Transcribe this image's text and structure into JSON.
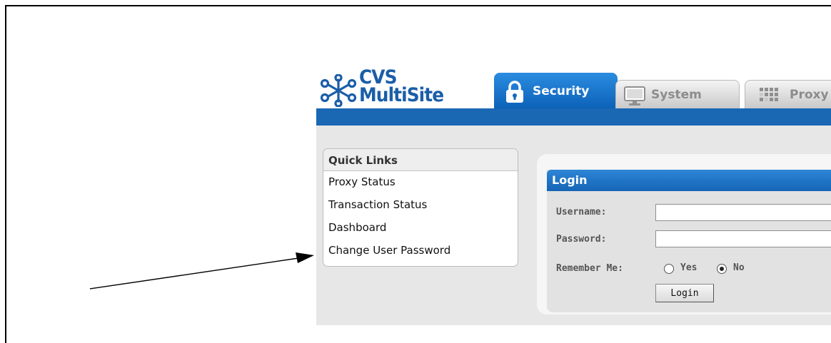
{
  "brand": {
    "line1": "CVS",
    "line2": "MultiSite",
    "color": "#1a5ea8"
  },
  "tabs": [
    {
      "label": "Security",
      "icon": "lock-icon",
      "active": true
    },
    {
      "label": "System",
      "icon": "monitor-icon",
      "active": false
    },
    {
      "label": "Proxy",
      "icon": "proxy-icon",
      "active": false
    }
  ],
  "quick_links": {
    "title": "Quick Links",
    "items": [
      {
        "label": "Proxy Status"
      },
      {
        "label": "Transaction Status"
      },
      {
        "label": "Dashboard"
      },
      {
        "label": "Change User Password"
      }
    ]
  },
  "login": {
    "title": "Login",
    "username_label": "Username:",
    "username_value": "",
    "password_label": "Password:",
    "password_value": "",
    "remember_label": "Remember Me:",
    "remember_yes": "Yes",
    "remember_no": "No",
    "remember_selected": "No",
    "submit_label": "Login"
  },
  "colors": {
    "accent": "#1a67b4",
    "panel_bg": "#e7e7e7"
  }
}
